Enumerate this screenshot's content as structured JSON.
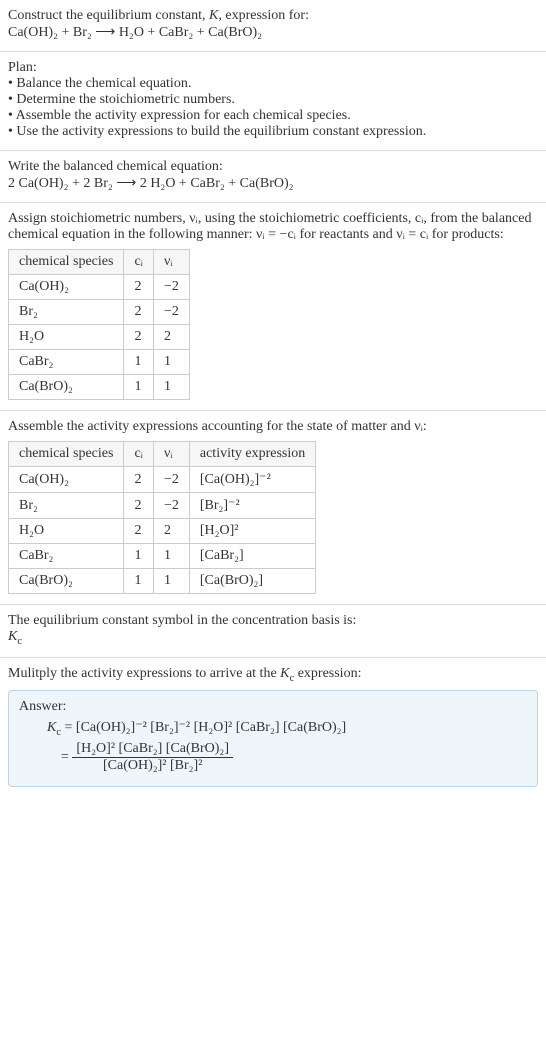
{
  "intro": {
    "line1": "Construct the equilibrium constant, K, expression for:",
    "equation": "Ca(OH)₂ + Br₂  ⟶  H₂O + CaBr₂ + Ca(BrO)₂"
  },
  "plan": {
    "heading": "Plan:",
    "b1": "• Balance the chemical equation.",
    "b2": "• Determine the stoichiometric numbers.",
    "b3": "• Assemble the activity expression for each chemical species.",
    "b4": "• Use the activity expressions to build the equilibrium constant expression."
  },
  "balanced": {
    "heading": "Write the balanced chemical equation:",
    "equation": "2 Ca(OH)₂ + 2 Br₂  ⟶  2 H₂O + CaBr₂ + Ca(BrO)₂"
  },
  "stoich": {
    "text1": "Assign stoichiometric numbers, νᵢ, using the stoichiometric coefficients, cᵢ, from the balanced chemical equation in the following manner: νᵢ = −cᵢ for reactants and νᵢ = cᵢ for products:",
    "headers": {
      "h1": "chemical species",
      "h2": "cᵢ",
      "h3": "νᵢ"
    },
    "rows": [
      {
        "sp": "Ca(OH)₂",
        "c": "2",
        "v": "−2"
      },
      {
        "sp": "Br₂",
        "c": "2",
        "v": "−2"
      },
      {
        "sp": "H₂O",
        "c": "2",
        "v": "2"
      },
      {
        "sp": "CaBr₂",
        "c": "1",
        "v": "1"
      },
      {
        "sp": "Ca(BrO)₂",
        "c": "1",
        "v": "1"
      }
    ]
  },
  "activity": {
    "heading": "Assemble the activity expressions accounting for the state of matter and νᵢ:",
    "headers": {
      "h1": "chemical species",
      "h2": "cᵢ",
      "h3": "νᵢ",
      "h4": "activity expression"
    },
    "rows": [
      {
        "sp": "Ca(OH)₂",
        "c": "2",
        "v": "−2",
        "a": "[Ca(OH)₂]⁻²"
      },
      {
        "sp": "Br₂",
        "c": "2",
        "v": "−2",
        "a": "[Br₂]⁻²"
      },
      {
        "sp": "H₂O",
        "c": "2",
        "v": "2",
        "a": "[H₂O]²"
      },
      {
        "sp": "CaBr₂",
        "c": "1",
        "v": "1",
        "a": "[CaBr₂]"
      },
      {
        "sp": "Ca(BrO)₂",
        "c": "1",
        "v": "1",
        "a": "[Ca(BrO)₂]"
      }
    ]
  },
  "symbol": {
    "line1": "The equilibrium constant symbol in the concentration basis is:",
    "line2": "K𞁞"
  },
  "multiply": {
    "heading": "Mulitply the activity expressions to arrive at the K𞁞 expression:"
  },
  "answer": {
    "label": "Answer:",
    "kc": "K𞁞 = ",
    "flat": "[Ca(OH)₂]⁻² [Br₂]⁻² [H₂O]² [CaBr₂] [Ca(BrO)₂]",
    "eq2": " = ",
    "num": "[H₂O]² [CaBr₂] [Ca(BrO)₂]",
    "den": "[Ca(OH)₂]² [Br₂]²"
  }
}
